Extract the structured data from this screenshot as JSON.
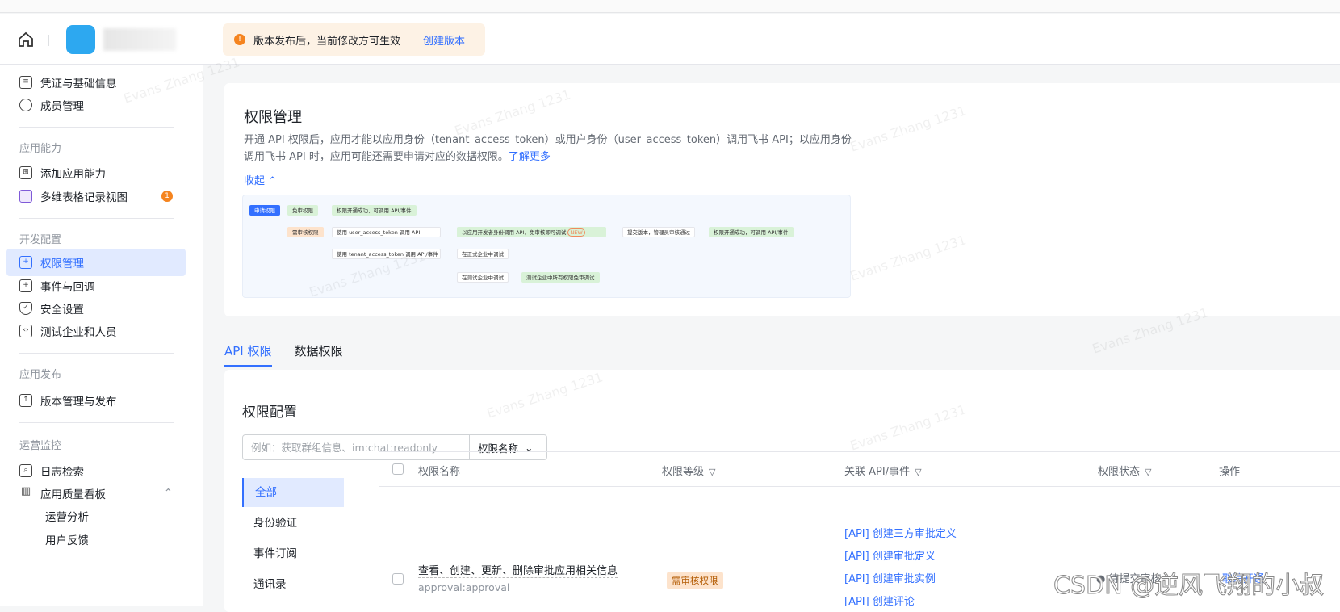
{
  "header": {
    "notice": "版本发布后，当前修改方可生效",
    "notice_action": "创建版本"
  },
  "sidebar": {
    "items_top": [
      {
        "label": "凭证与基础信息",
        "icon": "id-card-icon"
      },
      {
        "label": "成员管理",
        "icon": "user-add-icon"
      }
    ],
    "groups": [
      {
        "title": "应用能力",
        "items": [
          {
            "label": "添加应用能力",
            "icon": "apps-icon"
          },
          {
            "label": "多维表格记录视图",
            "icon": "table-icon",
            "badge": "1"
          }
        ]
      },
      {
        "title": "开发配置",
        "items": [
          {
            "label": "权限管理",
            "icon": "lock-icon",
            "active": true
          },
          {
            "label": "事件与回调",
            "icon": "event-icon"
          },
          {
            "label": "安全设置",
            "icon": "shield-icon"
          },
          {
            "label": "测试企业和人员",
            "icon": "code-icon"
          }
        ]
      },
      {
        "title": "应用发布",
        "items": [
          {
            "label": "版本管理与发布",
            "icon": "upload-icon"
          }
        ]
      },
      {
        "title": "运营监控",
        "items": [
          {
            "label": "日志检索",
            "icon": "search-log-icon"
          },
          {
            "label": "应用质量看板",
            "icon": "chart-icon"
          },
          {
            "label": "运营分析"
          },
          {
            "label": "用户反馈"
          }
        ]
      }
    ]
  },
  "permissions": {
    "title": "权限管理",
    "desc": "开通 API 权限后，应用才能以应用身份（tenant_access_token）或用户身份（user_access_token）调用飞书 API；以应用身份调用飞书 API 时，应用可能还需要申请对应的数据权限。",
    "learn_more": "了解更多",
    "collapse": "收起",
    "diagram": {
      "apply": "申请权限",
      "free": "免审权限",
      "success": "权限开通成功，可调用 API/事件",
      "review": "需审核权限",
      "user_token": "使用 user_access_token 调用 API",
      "dev_identity": "以应用开发者身份调用 API，免审核即可调试",
      "new": "NEW",
      "submit": "提交版本，管理员审核通过",
      "success2": "权限开通成功，可调用 API/事件",
      "tenant_token": "使用 tenant_access_token 调用 API/事件",
      "prod_debug": "在正式企业中调试",
      "test_debug": "在测试企业中调试",
      "test_free": "测试企业中所有权限免审调试"
    }
  },
  "tabs": [
    {
      "label": "API 权限",
      "active": true
    },
    {
      "label": "数据权限"
    }
  ],
  "config": {
    "title": "权限配置",
    "search_placeholder": "例如：获取群组信息、im:chat:readonly",
    "search_field": "权限名称",
    "categories": [
      "全部",
      "身份验证",
      "事件订阅",
      "通讯录"
    ],
    "columns": [
      "权限名称",
      "权限等级",
      "关联 API/事件",
      "权限状态",
      "操作"
    ],
    "rows": [
      {
        "name": "查看、创建、更新、删除审批应用相关信息",
        "scope": "approval:approval",
        "level": "需审核权限",
        "apis": [
          "[API] 创建三方审批定义",
          "[API] 创建审批定义",
          "[API] 创建审批实例",
          "[API] 创建评论"
        ],
        "status": "待提交审核",
        "action": "取消开通"
      }
    ]
  },
  "watermark": "Evans Zhang 1231",
  "csdn": "CSDN @逆风飞翔的小叔"
}
